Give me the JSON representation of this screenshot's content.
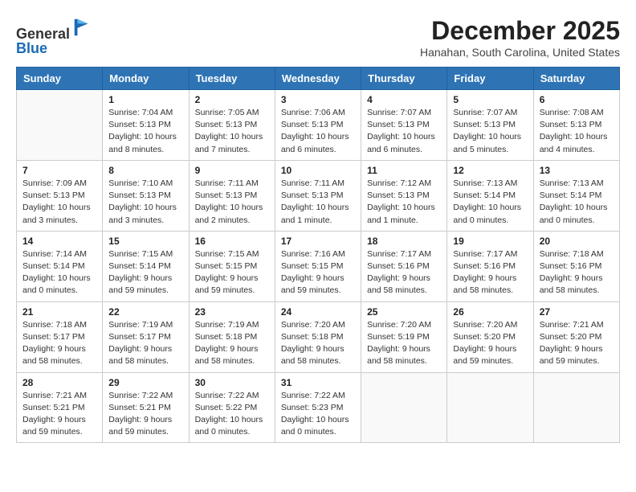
{
  "logo": {
    "general": "General",
    "blue": "Blue"
  },
  "header": {
    "month_year": "December 2025",
    "location": "Hanahan, South Carolina, United States"
  },
  "days_of_week": [
    "Sunday",
    "Monday",
    "Tuesday",
    "Wednesday",
    "Thursday",
    "Friday",
    "Saturday"
  ],
  "weeks": [
    [
      {
        "day": "",
        "info": ""
      },
      {
        "day": "1",
        "info": "Sunrise: 7:04 AM\nSunset: 5:13 PM\nDaylight: 10 hours\nand 8 minutes."
      },
      {
        "day": "2",
        "info": "Sunrise: 7:05 AM\nSunset: 5:13 PM\nDaylight: 10 hours\nand 7 minutes."
      },
      {
        "day": "3",
        "info": "Sunrise: 7:06 AM\nSunset: 5:13 PM\nDaylight: 10 hours\nand 6 minutes."
      },
      {
        "day": "4",
        "info": "Sunrise: 7:07 AM\nSunset: 5:13 PM\nDaylight: 10 hours\nand 6 minutes."
      },
      {
        "day": "5",
        "info": "Sunrise: 7:07 AM\nSunset: 5:13 PM\nDaylight: 10 hours\nand 5 minutes."
      },
      {
        "day": "6",
        "info": "Sunrise: 7:08 AM\nSunset: 5:13 PM\nDaylight: 10 hours\nand 4 minutes."
      }
    ],
    [
      {
        "day": "7",
        "info": "Sunrise: 7:09 AM\nSunset: 5:13 PM\nDaylight: 10 hours\nand 3 minutes."
      },
      {
        "day": "8",
        "info": "Sunrise: 7:10 AM\nSunset: 5:13 PM\nDaylight: 10 hours\nand 3 minutes."
      },
      {
        "day": "9",
        "info": "Sunrise: 7:11 AM\nSunset: 5:13 PM\nDaylight: 10 hours\nand 2 minutes."
      },
      {
        "day": "10",
        "info": "Sunrise: 7:11 AM\nSunset: 5:13 PM\nDaylight: 10 hours\nand 1 minute."
      },
      {
        "day": "11",
        "info": "Sunrise: 7:12 AM\nSunset: 5:13 PM\nDaylight: 10 hours\nand 1 minute."
      },
      {
        "day": "12",
        "info": "Sunrise: 7:13 AM\nSunset: 5:14 PM\nDaylight: 10 hours\nand 0 minutes."
      },
      {
        "day": "13",
        "info": "Sunrise: 7:13 AM\nSunset: 5:14 PM\nDaylight: 10 hours\nand 0 minutes."
      }
    ],
    [
      {
        "day": "14",
        "info": "Sunrise: 7:14 AM\nSunset: 5:14 PM\nDaylight: 10 hours\nand 0 minutes."
      },
      {
        "day": "15",
        "info": "Sunrise: 7:15 AM\nSunset: 5:14 PM\nDaylight: 9 hours\nand 59 minutes."
      },
      {
        "day": "16",
        "info": "Sunrise: 7:15 AM\nSunset: 5:15 PM\nDaylight: 9 hours\nand 59 minutes."
      },
      {
        "day": "17",
        "info": "Sunrise: 7:16 AM\nSunset: 5:15 PM\nDaylight: 9 hours\nand 59 minutes."
      },
      {
        "day": "18",
        "info": "Sunrise: 7:17 AM\nSunset: 5:16 PM\nDaylight: 9 hours\nand 58 minutes."
      },
      {
        "day": "19",
        "info": "Sunrise: 7:17 AM\nSunset: 5:16 PM\nDaylight: 9 hours\nand 58 minutes."
      },
      {
        "day": "20",
        "info": "Sunrise: 7:18 AM\nSunset: 5:16 PM\nDaylight: 9 hours\nand 58 minutes."
      }
    ],
    [
      {
        "day": "21",
        "info": "Sunrise: 7:18 AM\nSunset: 5:17 PM\nDaylight: 9 hours\nand 58 minutes."
      },
      {
        "day": "22",
        "info": "Sunrise: 7:19 AM\nSunset: 5:17 PM\nDaylight: 9 hours\nand 58 minutes."
      },
      {
        "day": "23",
        "info": "Sunrise: 7:19 AM\nSunset: 5:18 PM\nDaylight: 9 hours\nand 58 minutes."
      },
      {
        "day": "24",
        "info": "Sunrise: 7:20 AM\nSunset: 5:18 PM\nDaylight: 9 hours\nand 58 minutes."
      },
      {
        "day": "25",
        "info": "Sunrise: 7:20 AM\nSunset: 5:19 PM\nDaylight: 9 hours\nand 58 minutes."
      },
      {
        "day": "26",
        "info": "Sunrise: 7:20 AM\nSunset: 5:20 PM\nDaylight: 9 hours\nand 59 minutes."
      },
      {
        "day": "27",
        "info": "Sunrise: 7:21 AM\nSunset: 5:20 PM\nDaylight: 9 hours\nand 59 minutes."
      }
    ],
    [
      {
        "day": "28",
        "info": "Sunrise: 7:21 AM\nSunset: 5:21 PM\nDaylight: 9 hours\nand 59 minutes."
      },
      {
        "day": "29",
        "info": "Sunrise: 7:22 AM\nSunset: 5:21 PM\nDaylight: 9 hours\nand 59 minutes."
      },
      {
        "day": "30",
        "info": "Sunrise: 7:22 AM\nSunset: 5:22 PM\nDaylight: 10 hours\nand 0 minutes."
      },
      {
        "day": "31",
        "info": "Sunrise: 7:22 AM\nSunset: 5:23 PM\nDaylight: 10 hours\nand 0 minutes."
      },
      {
        "day": "",
        "info": ""
      },
      {
        "day": "",
        "info": ""
      },
      {
        "day": "",
        "info": ""
      }
    ]
  ]
}
